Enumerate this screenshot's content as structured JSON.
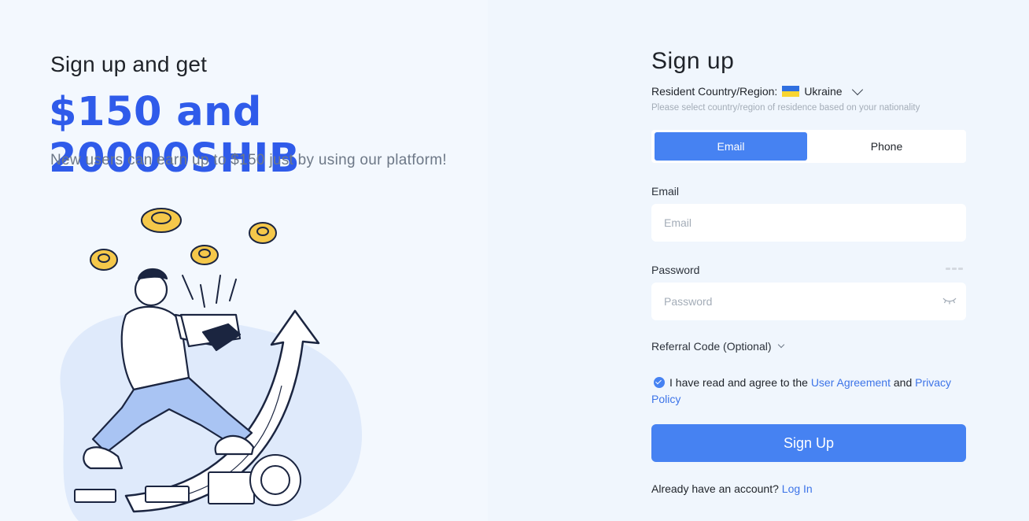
{
  "promo": {
    "intro": "Sign up and get",
    "headline": "$150 and 20000SHIB",
    "subtitle": "New users can earn up to $150 just by using our platform!"
  },
  "signup": {
    "title": "Sign up",
    "country_label": "Resident Country/Region:",
    "country_value": "Ukraine",
    "country_hint": "Please select country/region of residence based on your nationality",
    "tabs": [
      {
        "label": "Email",
        "active": true
      },
      {
        "label": "Phone",
        "active": false
      }
    ],
    "email_label": "Email",
    "email_placeholder": "Email",
    "email_value": "",
    "password_label": "Password",
    "password_placeholder": "Password",
    "password_value": "",
    "referral_label": "Referral Code (Optional)",
    "agree_prefix": "I have read and agree to the",
    "user_agreement_link": "User Agreement",
    "agree_and": "and",
    "privacy_link": "Privacy Policy",
    "submit_label": "Sign Up",
    "login_prompt": "Already have an account?",
    "login_link": "Log In"
  },
  "icons": {
    "flag": "ukraine-flag-icon",
    "country_dropdown": "chevron-down-icon",
    "password_toggle": "eye-closed-icon",
    "agree_checkbox": "check-circle-icon"
  },
  "colors": {
    "accent": "#4682f2",
    "headline": "#2f5bea",
    "link": "#3d74e8",
    "coin": "#f5c84a"
  }
}
